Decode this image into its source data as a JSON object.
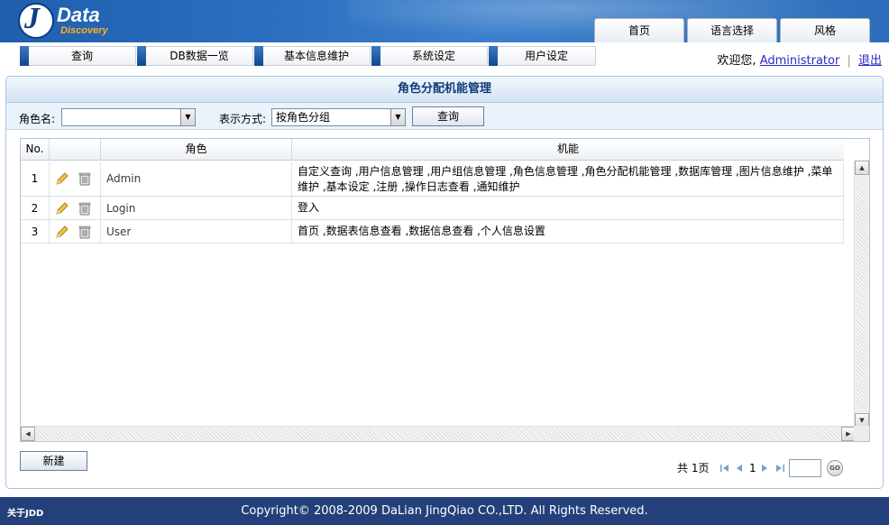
{
  "logo": {
    "letter": "J",
    "name": "Data",
    "tagline": "Discovery"
  },
  "top_tabs": [
    "首页",
    "语言选择",
    "风格"
  ],
  "nav": [
    "查询",
    "DB数据一览",
    "基本信息维护",
    "系统设定",
    "用户设定"
  ],
  "welcome": {
    "greeting": "欢迎您,",
    "user": "Administrator",
    "separator": "|",
    "logout": "退出"
  },
  "panel": {
    "title": "角色分配机能管理"
  },
  "filter": {
    "role_label": "角色名:",
    "role_value": "",
    "display_label": "表示方式:",
    "display_value": "按角色分组",
    "search_button": "查询"
  },
  "table": {
    "headers": [
      "No.",
      "",
      "角色",
      "机能"
    ],
    "rows": [
      {
        "no": "1",
        "role": "Admin",
        "functions": "自定义查询 ,用户信息管理 ,用户组信息管理 ,角色信息管理 ,角色分配机能管理 ,数据库管理 ,图片信息维护 ,菜单维护 ,基本设定 ,注册 ,操作日志查看 ,通知维护"
      },
      {
        "no": "2",
        "role": "Login",
        "functions": "登入"
      },
      {
        "no": "3",
        "role": "User",
        "functions": "首页 ,数据表信息查看 ,数据信息查看 ,个人信息设置"
      }
    ]
  },
  "new_button": "新建",
  "pager": {
    "total_label": "共 1页",
    "current_page": "1",
    "page_input": "",
    "go_label": "GO"
  },
  "footer": {
    "about": "关于JDD",
    "copyright": "Copyright© 2008-2009 DaLian JingQiao CO.,LTD. All Rights Reserved."
  },
  "colors": {
    "header_blue": "#2a6fbf",
    "footer_blue": "#24407a",
    "title_text": "#0e3c78",
    "link": "#2b28c8"
  }
}
